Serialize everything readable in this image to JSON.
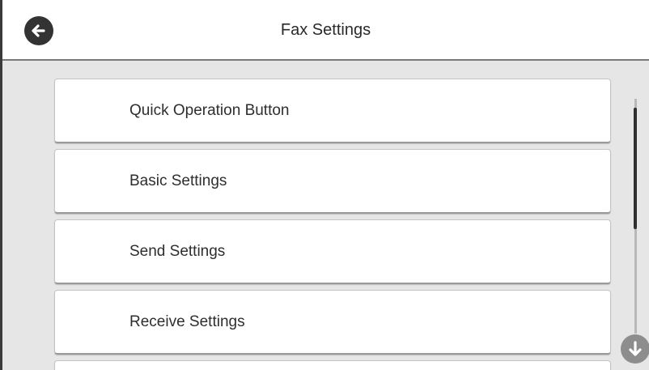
{
  "header": {
    "title": "Fax Settings",
    "back_icon": "arrow-left-circle-icon"
  },
  "menu": {
    "items": [
      {
        "label": "Quick Operation Button"
      },
      {
        "label": "Basic Settings"
      },
      {
        "label": "Send Settings"
      },
      {
        "label": "Receive Settings"
      }
    ]
  },
  "scroll": {
    "down_icon": "arrow-down-circle-icon"
  },
  "colors": {
    "background": "#e6e6e6",
    "header_background": "#ffffff",
    "icon_dark": "#333333",
    "icon_muted": "#8d8d8d"
  }
}
